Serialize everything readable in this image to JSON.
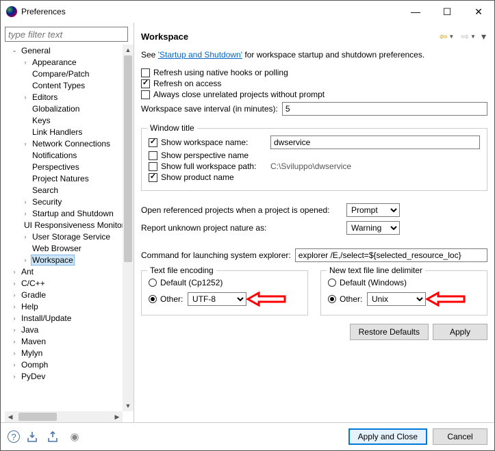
{
  "window": {
    "title": "Preferences"
  },
  "sidebar": {
    "filter_placeholder": "type filter text",
    "items": [
      {
        "d": 1,
        "exp": "v",
        "label": "General"
      },
      {
        "d": 2,
        "exp": ">",
        "label": "Appearance"
      },
      {
        "d": 2,
        "exp": "",
        "label": "Compare/Patch"
      },
      {
        "d": 2,
        "exp": "",
        "label": "Content Types"
      },
      {
        "d": 2,
        "exp": ">",
        "label": "Editors"
      },
      {
        "d": 2,
        "exp": "",
        "label": "Globalization"
      },
      {
        "d": 2,
        "exp": "",
        "label": "Keys"
      },
      {
        "d": 2,
        "exp": "",
        "label": "Link Handlers"
      },
      {
        "d": 2,
        "exp": ">",
        "label": "Network Connections"
      },
      {
        "d": 2,
        "exp": "",
        "label": "Notifications"
      },
      {
        "d": 2,
        "exp": "",
        "label": "Perspectives"
      },
      {
        "d": 2,
        "exp": "",
        "label": "Project Natures"
      },
      {
        "d": 2,
        "exp": "",
        "label": "Search"
      },
      {
        "d": 2,
        "exp": ">",
        "label": "Security"
      },
      {
        "d": 2,
        "exp": ">",
        "label": "Startup and Shutdown"
      },
      {
        "d": 2,
        "exp": "",
        "label": "UI Responsiveness Monitoring"
      },
      {
        "d": 2,
        "exp": ">",
        "label": "User Storage Service"
      },
      {
        "d": 2,
        "exp": "",
        "label": "Web Browser"
      },
      {
        "d": 2,
        "exp": ">",
        "label": "Workspace",
        "selected": true
      },
      {
        "d": 1,
        "exp": ">",
        "label": "Ant"
      },
      {
        "d": 1,
        "exp": ">",
        "label": "C/C++"
      },
      {
        "d": 1,
        "exp": ">",
        "label": "Gradle"
      },
      {
        "d": 1,
        "exp": ">",
        "label": "Help"
      },
      {
        "d": 1,
        "exp": ">",
        "label": "Install/Update"
      },
      {
        "d": 1,
        "exp": ">",
        "label": "Java"
      },
      {
        "d": 1,
        "exp": ">",
        "label": "Maven"
      },
      {
        "d": 1,
        "exp": ">",
        "label": "Mylyn"
      },
      {
        "d": 1,
        "exp": ">",
        "label": "Oomph"
      },
      {
        "d": 1,
        "exp": ">",
        "label": "PyDev"
      }
    ]
  },
  "main": {
    "heading": "Workspace",
    "intro_prefix": "See ",
    "intro_link": "'Startup and Shutdown'",
    "intro_suffix": " for workspace startup and shutdown preferences.",
    "chk_refresh_native": "Refresh using native hooks or polling",
    "chk_refresh_access": "Refresh on access",
    "chk_close_unrelated": "Always close unrelated projects without prompt",
    "save_interval_label": "Workspace save interval (in minutes):",
    "save_interval_value": "5",
    "window_title_group": "Window title",
    "chk_show_ws_name": "Show workspace name:",
    "ws_name_value": "dwservice",
    "chk_show_perspective": "Show perspective name",
    "chk_show_full_path": "Show full workspace path:",
    "full_path_value": "C:\\Sviluppo\\dwservice",
    "chk_show_product": "Show product name",
    "open_ref_label": "Open referenced projects when a project is opened:",
    "open_ref_value": "Prompt",
    "unknown_nature_label": "Report unknown project nature as:",
    "unknown_nature_value": "Warning",
    "cmd_label": "Command for launching system explorer:",
    "cmd_value": "explorer /E,/select=${selected_resource_loc}",
    "enc_group": "Text file encoding",
    "enc_default": "Default (Cp1252)",
    "enc_other_label": "Other:",
    "enc_other_value": "UTF-8",
    "delim_group": "New text file line delimiter",
    "delim_default": "Default (Windows)",
    "delim_other_label": "Other:",
    "delim_other_value": "Unix",
    "btn_restore": "Restore Defaults",
    "btn_apply": "Apply",
    "btn_apply_close": "Apply and Close",
    "btn_cancel": "Cancel"
  }
}
